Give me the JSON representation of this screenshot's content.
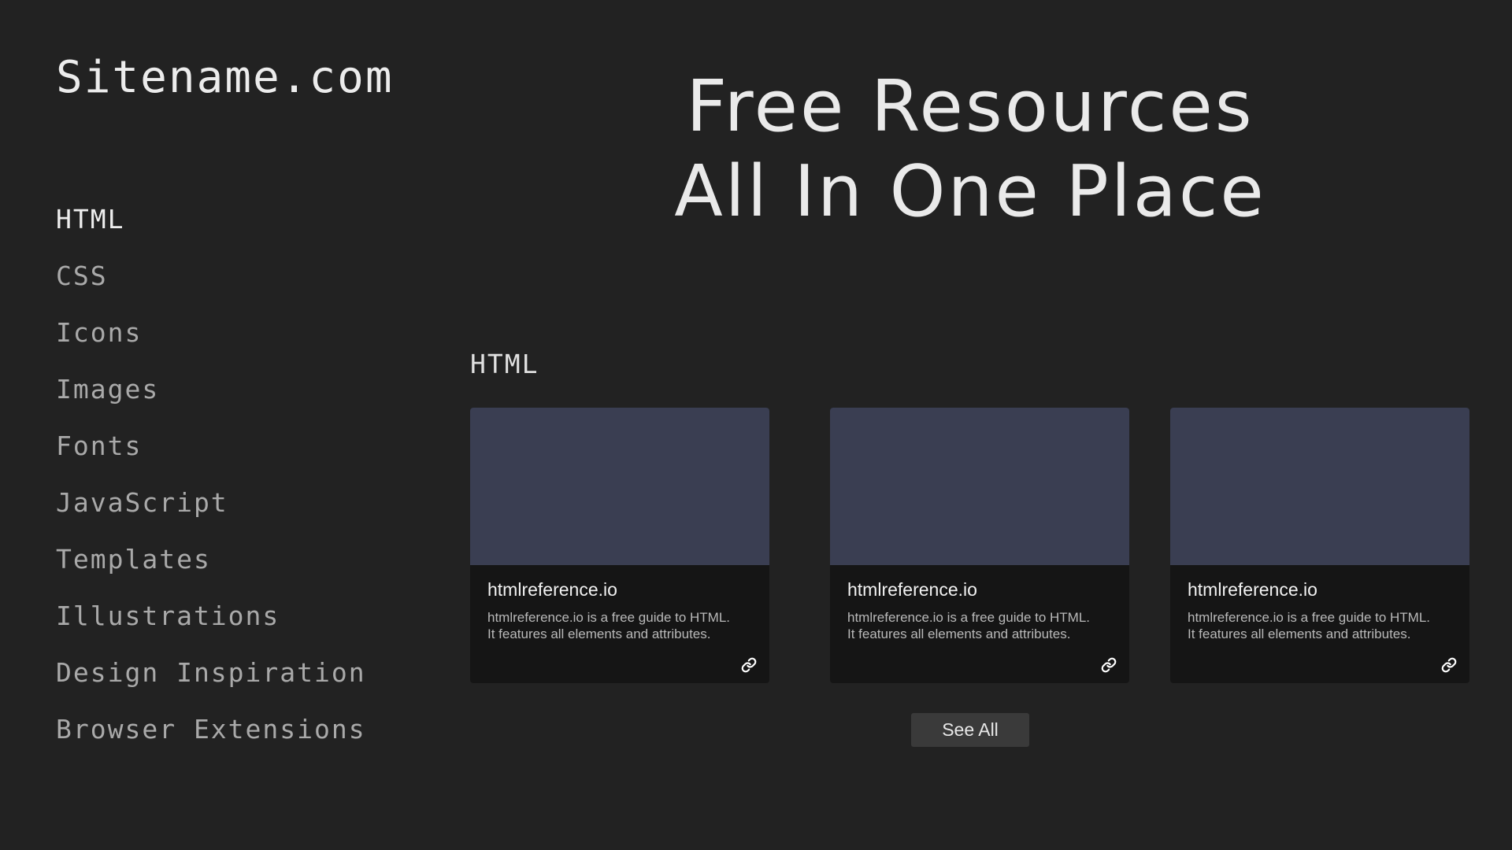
{
  "site": {
    "name": "Sitename.com"
  },
  "sidebar": {
    "items": [
      {
        "label": "HTML",
        "active": true
      },
      {
        "label": "CSS"
      },
      {
        "label": "Icons"
      },
      {
        "label": "Images"
      },
      {
        "label": "Fonts"
      },
      {
        "label": "JavaScript"
      },
      {
        "label": "Templates"
      },
      {
        "label": "Illustrations"
      },
      {
        "label": "Design Inspiration"
      },
      {
        "label": "Browser Extensions"
      }
    ]
  },
  "hero": {
    "line1": "Free Resources",
    "line2": "All In One Place"
  },
  "section": {
    "title": "HTML",
    "cards": [
      {
        "title": "htmlreference.io",
        "desc_line1": "htmlreference.io is a free guide to HTML.",
        "desc_line2": "It features all elements and attributes.",
        "icon": "link-icon"
      },
      {
        "title": "htmlreference.io",
        "desc_line1": "htmlreference.io is a free guide to HTML.",
        "desc_line2": "It features all elements and attributes.",
        "icon": "link-icon"
      },
      {
        "title": "htmlreference.io",
        "desc_line1": "htmlreference.io is a free guide to HTML.",
        "desc_line2": "It features all elements and attributes.",
        "icon": "link-icon"
      }
    ],
    "see_all_label": "See All"
  },
  "colors": {
    "background": "#222222",
    "card_background": "#151515",
    "thumbnail": "#3a3e52",
    "button": "#3a3a3a"
  }
}
